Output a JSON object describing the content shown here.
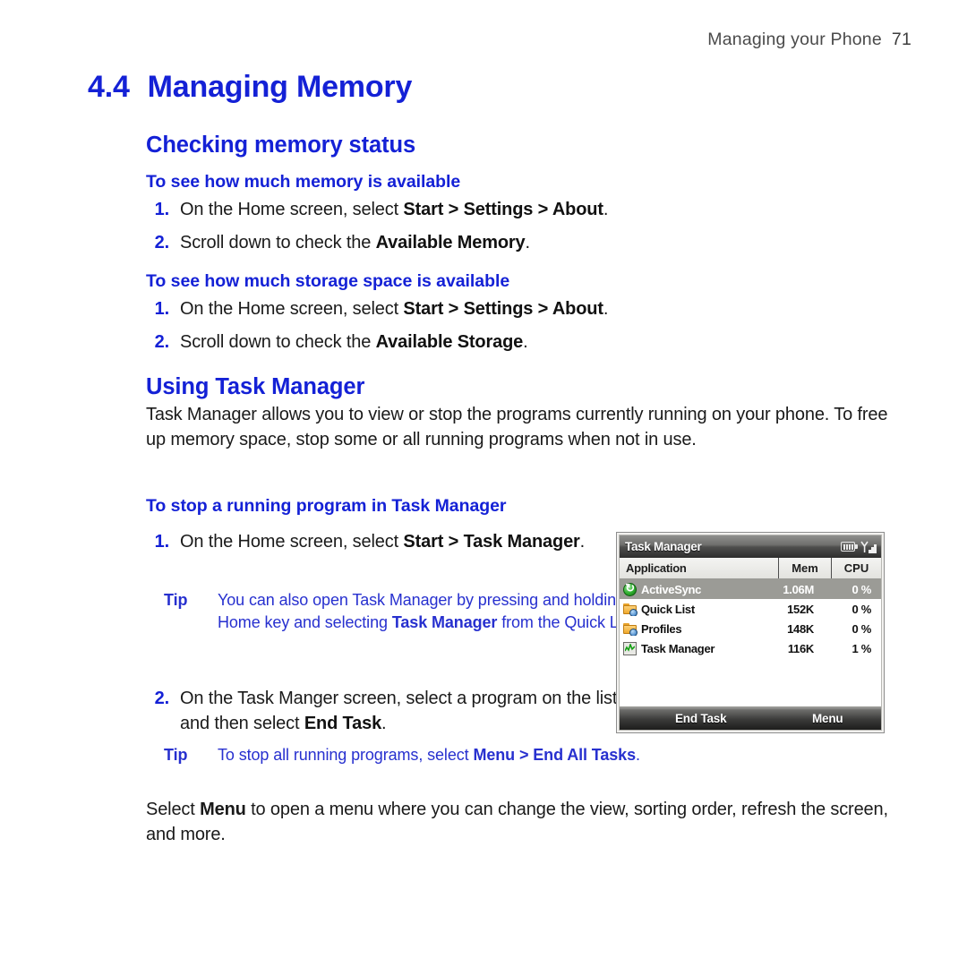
{
  "page": {
    "running_head": "Managing your Phone",
    "page_number": "71"
  },
  "section": {
    "number": "4.4",
    "title": "Managing Memory"
  },
  "checking_memory": {
    "heading": "Checking memory status",
    "sub_memory": {
      "heading": "To see how much memory is available",
      "steps": [
        {
          "n": "1.",
          "pre": "On the Home screen, select ",
          "bold": "Start > Settings > About",
          "post": "."
        },
        {
          "n": "2.",
          "pre": "Scroll down to check the ",
          "bold": "Available Memory",
          "post": "."
        }
      ]
    },
    "sub_storage": {
      "heading": "To see how much storage space is available",
      "steps": [
        {
          "n": "1.",
          "pre": "On the Home screen, select ",
          "bold": "Start > Settings > About",
          "post": "."
        },
        {
          "n": "2.",
          "pre": "Scroll down to check the ",
          "bold": "Available Storage",
          "post": "."
        }
      ]
    }
  },
  "task_manager": {
    "heading": "Using Task Manager",
    "intro": "Task Manager allows you to view or stop the programs currently running on your phone. To free up memory space, stop some or all running programs when not in use.",
    "sub_stop": {
      "heading": "To stop a running program in Task Manager",
      "step1": {
        "n": "1.",
        "pre": "On the Home screen, select ",
        "bold": "Start > Task Manager",
        "post": "."
      },
      "tip1": {
        "label": "Tip",
        "pre": "You can also open Task Manager by pressing and holding the Home key and selecting ",
        "bold": "Task Manager",
        "post": " from the Quick List."
      },
      "step2": {
        "n": "2.",
        "pre": "On the Task Manger screen, select a program on the list and then select ",
        "bold": "End Task",
        "post": "."
      },
      "tip2": {
        "label": "Tip",
        "pre": "To stop all running programs, select ",
        "bold": "Menu > End All Tasks",
        "post": "."
      }
    },
    "outro": {
      "pre": "Select ",
      "bold": "Menu",
      "post": " to open a menu where you can change the view, sorting order, refresh the screen, and more."
    }
  },
  "screenshot": {
    "title": "Task Manager",
    "status_icons": [
      "battery-icon",
      "signal-icon"
    ],
    "columns": [
      "Application",
      "Mem",
      "CPU"
    ],
    "rows": [
      {
        "icon": "activesync-icon",
        "app": "ActiveSync",
        "mem": "1.06M",
        "cpu": "0 %",
        "selected": true
      },
      {
        "icon": "folder-gear-icon",
        "app": "Quick List",
        "mem": "152K",
        "cpu": "0 %",
        "selected": false
      },
      {
        "icon": "folder-gear-icon",
        "app": "Profiles",
        "mem": "148K",
        "cpu": "0 %",
        "selected": false
      },
      {
        "icon": "chart-icon",
        "app": "Task Manager",
        "mem": "116K",
        "cpu": "1 %",
        "selected": false
      }
    ],
    "softkey_left": "End Task",
    "softkey_right": "Menu"
  },
  "colors": {
    "heading_blue": "#1421d6",
    "tip_blue": "#2730cf",
    "body_black": "#1a1a1a",
    "row_selected": "#9b9b96"
  }
}
